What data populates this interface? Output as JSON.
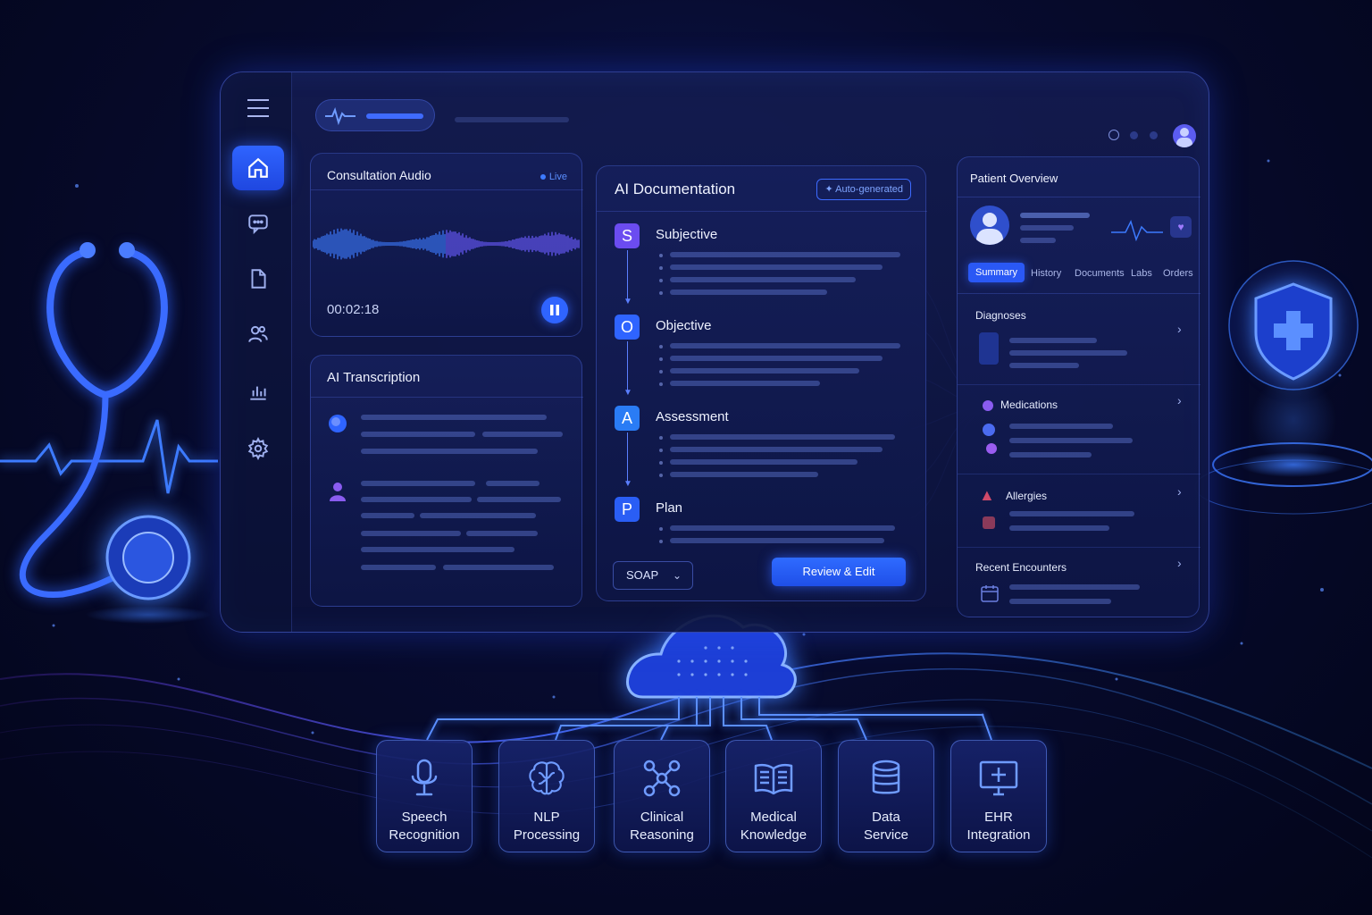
{
  "colors": {
    "accent": "#2f64ff",
    "background": "#070b2e",
    "glow": "#3d7bff",
    "soap_s": "#6b4cf0",
    "soap_o": "#2f64ff",
    "soap_a": "#2a7cf5",
    "soap_p": "#2a5ef5"
  },
  "sidebar": {
    "items": [
      {
        "icon": "home-icon",
        "active": true
      },
      {
        "icon": "chat-icon"
      },
      {
        "icon": "document-icon"
      },
      {
        "icon": "users-icon"
      },
      {
        "icon": "chart-icon"
      },
      {
        "icon": "gear-icon"
      }
    ]
  },
  "audio": {
    "title": "Consultation Audio",
    "live": "Live",
    "timer": "00:02:18"
  },
  "transcription": {
    "title": "AI Transcription"
  },
  "documentation": {
    "title": "AI Documentation",
    "badge": "Auto-generated",
    "sections": [
      {
        "letter": "S",
        "label": "Subjective"
      },
      {
        "letter": "O",
        "label": "Objective"
      },
      {
        "letter": "A",
        "label": "Assessment"
      },
      {
        "letter": "P",
        "label": "Plan"
      }
    ],
    "format_select": "SOAP",
    "review_button": "Review & Edit"
  },
  "patient": {
    "title": "Patient Overview",
    "tabs": [
      "Summary",
      "History",
      "Documents",
      "Labs",
      "Orders"
    ],
    "active_tab": "Summary",
    "sections": {
      "diagnoses": "Diagnoses",
      "medications": "Medications",
      "allergies": "Allergies",
      "encounters": "Recent Encounters"
    }
  },
  "services": [
    {
      "icon": "microphone-icon",
      "line1": "Speech",
      "line2": "Recognition"
    },
    {
      "icon": "brain-icon",
      "line1": "NLP",
      "line2": "Processing"
    },
    {
      "icon": "network-icon",
      "line1": "Clinical",
      "line2": "Reasoning"
    },
    {
      "icon": "book-icon",
      "line1": "Medical",
      "line2": "Knowledge"
    },
    {
      "icon": "database-icon",
      "line1": "Data",
      "line2": "Service"
    },
    {
      "icon": "monitor-plus-icon",
      "line1": "EHR",
      "line2": "Integration"
    }
  ]
}
